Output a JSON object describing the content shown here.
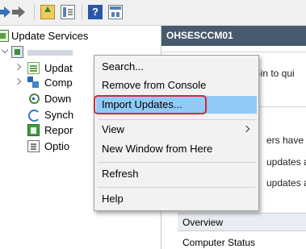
{
  "tree": {
    "root_label": "Update Services",
    "children": [
      {
        "label": "Updat"
      },
      {
        "label": "Comp"
      },
      {
        "label": "Down"
      },
      {
        "label": "Synch"
      },
      {
        "label": "Repor"
      },
      {
        "label": "Optio"
      }
    ]
  },
  "right": {
    "header": "OHSESCCM01",
    "line_1": "p-in to qui",
    "line_2": "ers have r",
    "line_3": "updates a",
    "line_4": "updates are",
    "overview": "Overview",
    "computer_status": "Computer Status"
  },
  "context_menu": {
    "items": [
      {
        "label": "Search..."
      },
      {
        "label": "Remove from Console"
      },
      {
        "label": "Import Updates..."
      },
      {
        "label": "View"
      },
      {
        "label": "New Window from Here"
      },
      {
        "label": "Refresh"
      },
      {
        "label": "Help"
      }
    ],
    "highlight_color": "#91c9f7",
    "annotation_color": "#d12a36"
  },
  "colors": {
    "header_bg": "#475a6e",
    "toolbar_bg": "#f0f0f0"
  }
}
